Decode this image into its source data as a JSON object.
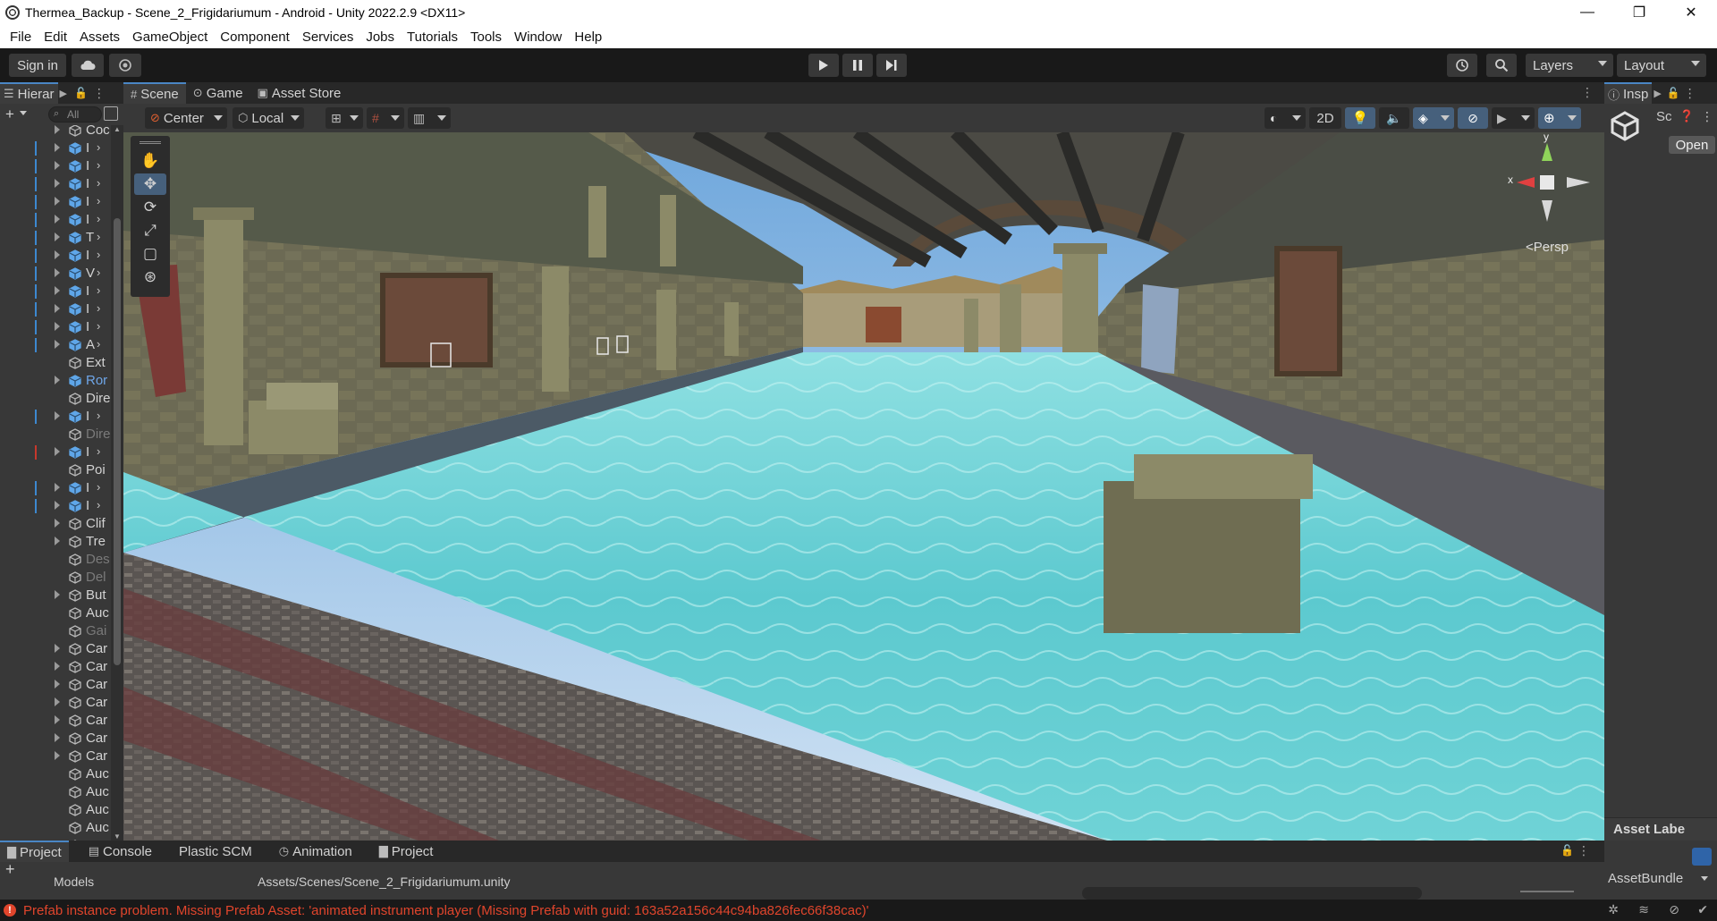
{
  "window": {
    "title": "Thermea_Backup - Scene_2_Frigidariumum - Android - Unity 2022.2.9 <DX11>",
    "minimize": "—",
    "maximize": "❐",
    "close": "✕"
  },
  "menu": [
    "File",
    "Edit",
    "Assets",
    "GameObject",
    "Component",
    "Services",
    "Jobs",
    "Tutorials",
    "Tools",
    "Window",
    "Help"
  ],
  "toolbar": {
    "sign_in": "Sign in",
    "layers": "Layers",
    "layout": "Layout"
  },
  "hierarchy": {
    "tab": "Hierar",
    "search_placeholder": "All",
    "rows": [
      {
        "name": "Coc",
        "type": "obj",
        "mark": "none",
        "fold": true,
        "arrow": false,
        "style": ""
      },
      {
        "name": "I",
        "type": "prefab",
        "mark": "blue",
        "fold": true,
        "arrow": true,
        "style": ""
      },
      {
        "name": "I",
        "type": "prefab",
        "mark": "blue",
        "fold": true,
        "arrow": true,
        "style": ""
      },
      {
        "name": "I",
        "type": "prefab",
        "mark": "blue",
        "fold": true,
        "arrow": true,
        "style": ""
      },
      {
        "name": "I",
        "type": "prefab",
        "mark": "blue",
        "fold": true,
        "arrow": true,
        "style": ""
      },
      {
        "name": "I",
        "type": "prefab",
        "mark": "blue",
        "fold": true,
        "arrow": true,
        "style": ""
      },
      {
        "name": "T",
        "type": "prefab",
        "mark": "blue",
        "fold": true,
        "arrow": true,
        "style": ""
      },
      {
        "name": "I",
        "type": "prefab",
        "mark": "blue",
        "fold": true,
        "arrow": true,
        "style": ""
      },
      {
        "name": "V",
        "type": "prefab",
        "mark": "blue",
        "fold": true,
        "arrow": true,
        "style": ""
      },
      {
        "name": "I",
        "type": "prefab",
        "mark": "blue",
        "fold": true,
        "arrow": true,
        "style": ""
      },
      {
        "name": "I",
        "type": "prefab",
        "mark": "blue",
        "fold": true,
        "arrow": true,
        "style": ""
      },
      {
        "name": "I",
        "type": "prefab",
        "mark": "blue",
        "fold": true,
        "arrow": true,
        "style": ""
      },
      {
        "name": "A",
        "type": "prefab",
        "mark": "blue",
        "fold": true,
        "arrow": true,
        "style": ""
      },
      {
        "name": "Ext",
        "type": "obj",
        "mark": "none",
        "fold": false,
        "arrow": false,
        "style": ""
      },
      {
        "name": "Ror",
        "type": "prefab",
        "mark": "none",
        "fold": true,
        "arrow": false,
        "style": "blue"
      },
      {
        "name": "Dire",
        "type": "obj",
        "mark": "none",
        "fold": false,
        "arrow": false,
        "style": ""
      },
      {
        "name": "I",
        "type": "prefab",
        "mark": "blue",
        "fold": true,
        "arrow": true,
        "style": ""
      },
      {
        "name": "Dire",
        "type": "obj",
        "mark": "none",
        "fold": false,
        "arrow": false,
        "style": "dim"
      },
      {
        "name": "I",
        "type": "prefab",
        "mark": "red",
        "fold": true,
        "arrow": true,
        "style": ""
      },
      {
        "name": "Poi",
        "type": "obj",
        "mark": "none",
        "fold": false,
        "arrow": false,
        "style": ""
      },
      {
        "name": "I",
        "type": "prefab",
        "mark": "blue",
        "fold": true,
        "arrow": true,
        "style": ""
      },
      {
        "name": "I",
        "type": "prefab",
        "mark": "blue",
        "fold": true,
        "arrow": true,
        "style": ""
      },
      {
        "name": "Clif",
        "type": "obj",
        "mark": "none",
        "fold": true,
        "arrow": false,
        "style": ""
      },
      {
        "name": "Tre",
        "type": "obj",
        "mark": "none",
        "fold": true,
        "arrow": false,
        "style": ""
      },
      {
        "name": "Des",
        "type": "obj",
        "mark": "none",
        "fold": false,
        "arrow": false,
        "style": "dim"
      },
      {
        "name": "Del",
        "type": "obj",
        "mark": "none",
        "fold": false,
        "arrow": false,
        "style": "dim"
      },
      {
        "name": "But",
        "type": "obj",
        "mark": "none",
        "fold": true,
        "arrow": false,
        "style": ""
      },
      {
        "name": "Auc",
        "type": "obj",
        "mark": "none",
        "fold": false,
        "arrow": false,
        "style": ""
      },
      {
        "name": "Gai",
        "type": "obj",
        "mark": "none",
        "fold": false,
        "arrow": false,
        "style": "dim"
      },
      {
        "name": "Car",
        "type": "obj",
        "mark": "none",
        "fold": true,
        "arrow": false,
        "style": ""
      },
      {
        "name": "Car",
        "type": "obj",
        "mark": "none",
        "fold": true,
        "arrow": false,
        "style": ""
      },
      {
        "name": "Car",
        "type": "obj",
        "mark": "none",
        "fold": true,
        "arrow": false,
        "style": ""
      },
      {
        "name": "Car",
        "type": "obj",
        "mark": "none",
        "fold": true,
        "arrow": false,
        "style": ""
      },
      {
        "name": "Car",
        "type": "obj",
        "mark": "none",
        "fold": true,
        "arrow": false,
        "style": ""
      },
      {
        "name": "Car",
        "type": "obj",
        "mark": "none",
        "fold": true,
        "arrow": false,
        "style": ""
      },
      {
        "name": "Car",
        "type": "obj",
        "mark": "none",
        "fold": true,
        "arrow": false,
        "style": ""
      },
      {
        "name": "Auc",
        "type": "obj",
        "mark": "none",
        "fold": false,
        "arrow": false,
        "style": ""
      },
      {
        "name": "Auc",
        "type": "obj",
        "mark": "none",
        "fold": false,
        "arrow": false,
        "style": ""
      },
      {
        "name": "Auc",
        "type": "obj",
        "mark": "none",
        "fold": false,
        "arrow": false,
        "style": ""
      },
      {
        "name": "Auc",
        "type": "obj",
        "mark": "none",
        "fold": false,
        "arrow": false,
        "style": ""
      },
      {
        "name": "Auc",
        "type": "obj",
        "mark": "none",
        "fold": false,
        "arrow": false,
        "style": ""
      }
    ]
  },
  "scene": {
    "tabs": [
      "Scene",
      "Game",
      "Asset Store"
    ],
    "pivot": "Center",
    "space": "Local",
    "mode_2d": "2D",
    "gizmo": {
      "x": "x",
      "y": "y",
      "view": "<Persp"
    }
  },
  "inspector": {
    "tab": "Insp",
    "obj_name": "Sc",
    "open_button": "Open",
    "asset_labels": "Asset Labe",
    "asset_bundle": "AssetBundle"
  },
  "bottom": {
    "tabs": [
      "Project",
      "Console",
      "Plastic SCM",
      "Animation",
      "Project"
    ],
    "tree_item": "Models",
    "path": "Assets/Scenes/Scene_2_Frigidariumum.unity"
  },
  "status": {
    "message": "Prefab instance problem. Missing Prefab Asset: 'animated instrument player (Missing Prefab with guid: 163a52a156c44c94ba826fec66f38cac)'"
  },
  "colors": {
    "accent": "#4a86c5",
    "error": "#e0452c",
    "prefab": "#5fa6e8"
  }
}
